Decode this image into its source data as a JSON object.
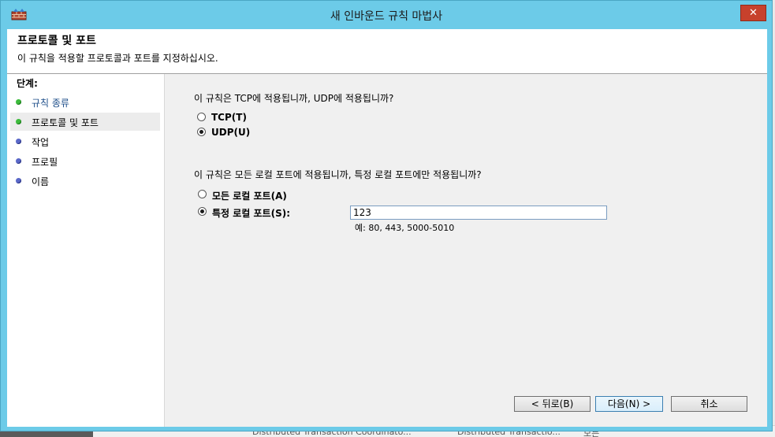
{
  "window": {
    "title": "새 인바운드 규칙 마법사",
    "close_label": "✕"
  },
  "header": {
    "title": "프로토콜 및 포트",
    "subtitle": "이 규칙을 적용할 프로토콜과 포트를 지정하십시오."
  },
  "steps": {
    "title": "단계:",
    "items": [
      {
        "label": "규칙 종류",
        "state": "done"
      },
      {
        "label": "프로토콜 및 포트",
        "state": "current"
      },
      {
        "label": "작업",
        "state": "pending"
      },
      {
        "label": "프로필",
        "state": "pending"
      },
      {
        "label": "이름",
        "state": "pending"
      }
    ]
  },
  "protocol": {
    "question": "이 규칙은 TCP에 적용됩니까, UDP에 적용됩니까?",
    "options": [
      {
        "label": "TCP(T)",
        "checked": false
      },
      {
        "label": "UDP(U)",
        "checked": true
      }
    ]
  },
  "ports": {
    "question": "이 규칙은 모든 로컬 포트에 적용됩니까, 특정 로컬 포트에만 적용됩니까?",
    "all_label": "모든 로컬 포트(A)",
    "specific_label": "특정 로컬 포트(S):",
    "specific_checked": true,
    "value": "123",
    "hint": "예: 80, 443, 5000-5010"
  },
  "buttons": {
    "back": "< 뒤로(B)",
    "next": "다음(N) >",
    "cancel": "취소"
  },
  "background": {
    "text1": "Distributed Transaction Coordinato...",
    "text2": "Distributed Transactio...",
    "text3": "모든"
  }
}
